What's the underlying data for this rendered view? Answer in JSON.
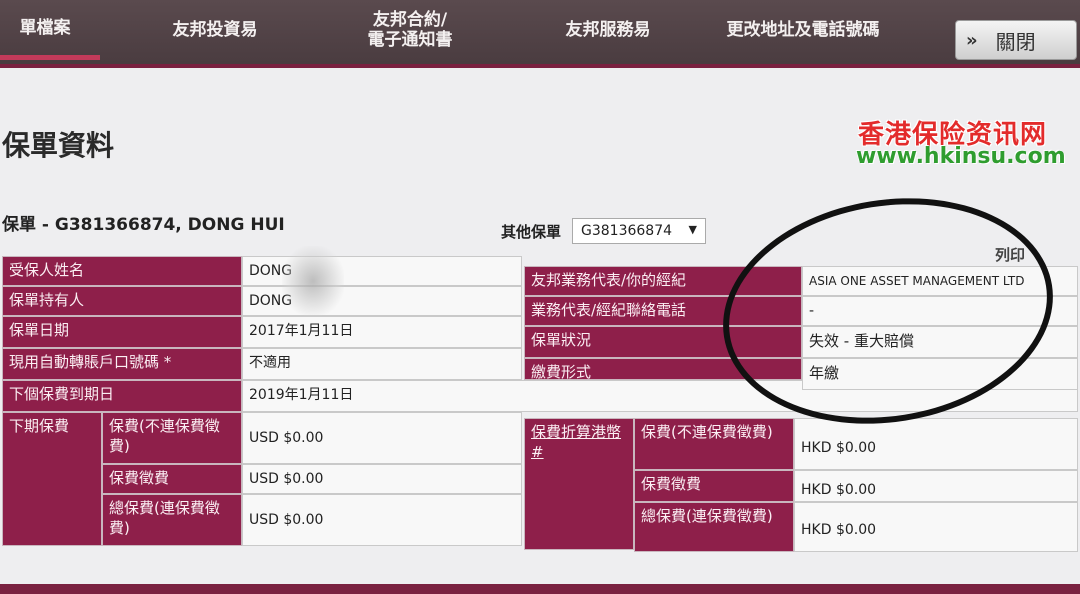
{
  "nav": {
    "items": [
      {
        "label": "單檔案"
      },
      {
        "label": "友邦投資易"
      },
      {
        "label": "友邦合約/\n電子通知書"
      },
      {
        "label": "友邦服務易"
      },
      {
        "label": "更改地址及電話號碼"
      }
    ],
    "close_label": "關閉",
    "close_icon": "double-chevron-right-icon"
  },
  "page": {
    "title": "保單資料",
    "policy_line": "保單 - G381366874, DONG HUI",
    "other_policy_label": "其他保單",
    "other_policy_value": "G381366874",
    "print_label": "列印"
  },
  "watermark": {
    "name": "香港保险资讯网",
    "url": "www.hkinsu.com"
  },
  "left_table": {
    "rows": [
      {
        "label": "受保人姓名",
        "value": "DONG"
      },
      {
        "label": "保單持有人",
        "value": "DONG"
      },
      {
        "label": "保單日期",
        "value": "2017年1月11日"
      },
      {
        "label": "現用自動轉賬戶口號碼 *",
        "value": "不適用"
      },
      {
        "label": "下個保費到期日",
        "value": "2019年1月11日"
      }
    ]
  },
  "right_table": {
    "rows": [
      {
        "label": "友邦業務代表/你的經紀",
        "value": "ASIA ONE ASSET MANAGEMENT LTD"
      },
      {
        "label": "業務代表/經紀聯絡電話",
        "value": "-"
      },
      {
        "label": "保單狀況",
        "value": "失效 - 重大賠償"
      },
      {
        "label": "繳費形式",
        "value": "年繳"
      }
    ]
  },
  "next_premium": {
    "label": "下期保費",
    "rows": [
      {
        "label": "保費(不連保費徵費)",
        "value": "USD  $0.00"
      },
      {
        "label": "保費徵費",
        "value": "USD  $0.00"
      },
      {
        "label": "總保費(連保費徵費)",
        "value": "USD  $0.00"
      }
    ]
  },
  "converted_premium": {
    "label": "保費折算港幣 #",
    "rows": [
      {
        "label": "保費(不連保費徵費)",
        "value": "HKD $0.00"
      },
      {
        "label": "保費徵費",
        "value": "HKD $0.00"
      },
      {
        "label": "總保費(連保費徵費)",
        "value": "HKD $0.00"
      }
    ]
  }
}
